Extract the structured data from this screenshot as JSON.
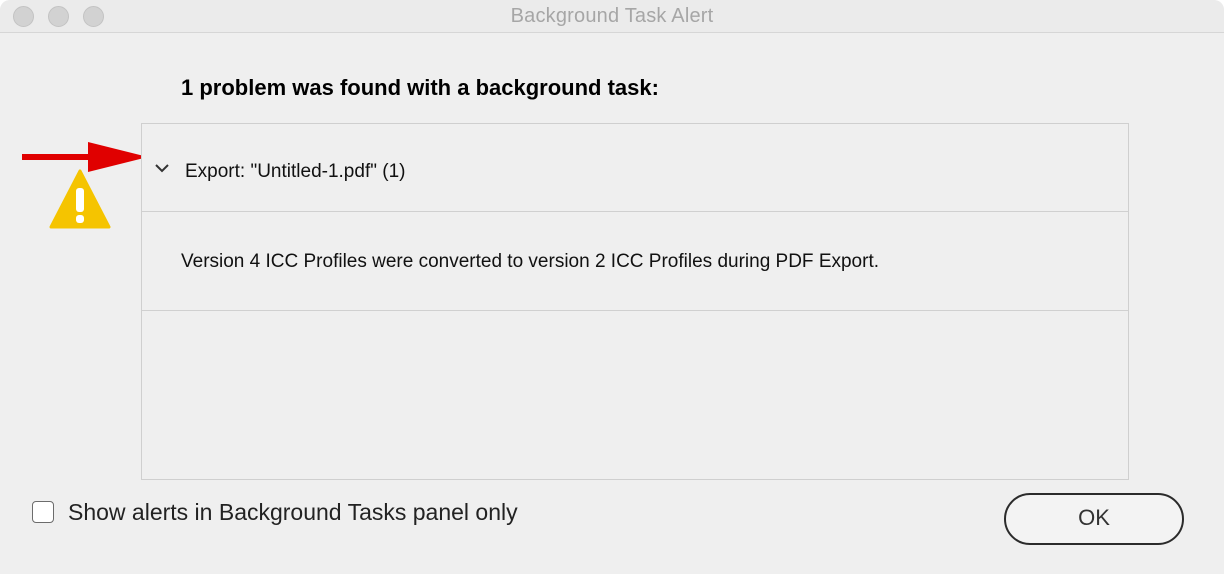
{
  "window": {
    "title": "Background Task Alert"
  },
  "dialog": {
    "heading": "1 problem was found with a background task:",
    "tasks": [
      {
        "label": "Export: \"Untitled-1.pdf\" (1)",
        "expanded": true,
        "detail": "Version 4 ICC Profiles were converted to version 2 ICC Profiles during PDF Export."
      }
    ],
    "checkbox": {
      "label": "Show alerts in Background Tasks panel only",
      "checked": false
    },
    "ok_label": "OK"
  },
  "icons": {
    "warning": "warning-triangle-icon",
    "chevron": "chevron-down-icon",
    "annotation": "red-arrow-annotation"
  },
  "colors": {
    "warning_yellow": "#f5c400",
    "annotation_red": "#e00000",
    "window_bg": "#efefef"
  }
}
